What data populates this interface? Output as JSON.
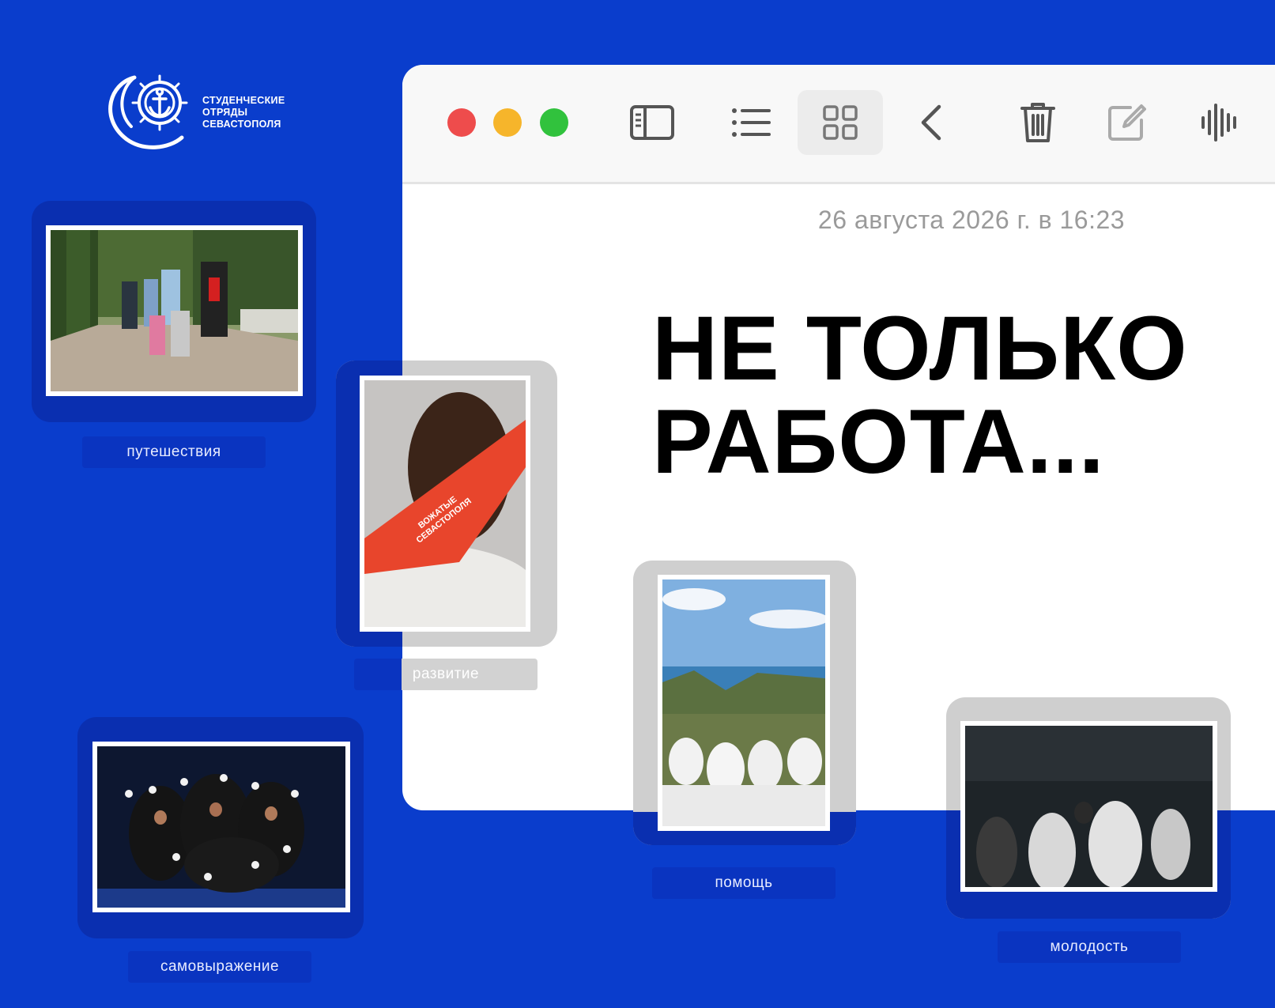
{
  "brand": {
    "line1": "СТУДЕНЧЕСКИЕ",
    "line2": "ОТРЯДЫ",
    "line3": "СЕВАСТОПОЛЯ",
    "icon": "anchor-helm-icon"
  },
  "window": {
    "toolbar": {
      "buttons": [
        "sidebar-icon",
        "list-icon",
        "grid-icon",
        "back-icon",
        "trash-icon",
        "compose-icon",
        "audio-wave-icon"
      ],
      "active": "grid-icon"
    },
    "date": "26 августа 2026 г. в 16:23",
    "headline_line1": "НЕ ТОЛЬКО",
    "headline_line2": "РАБОТА..."
  },
  "photos": {
    "travel": {
      "caption": "путешествия"
    },
    "development": {
      "caption": "развитие",
      "scarf_text": "ВОЖАТЫЕ СЕВАСТОПОЛЯ"
    },
    "help": {
      "caption": "помощь"
    },
    "youth": {
      "caption": "молодость"
    },
    "expression": {
      "caption": "самовыражение"
    }
  },
  "colors": {
    "background": "#0a3dcc",
    "card_blue": "#0a2fb0",
    "card_grey": "#cfcfcf",
    "mac_red": "#ee4c4c",
    "mac_yellow": "#f6b52b",
    "mac_green": "#31c23d",
    "scarf": "#e8452c"
  }
}
